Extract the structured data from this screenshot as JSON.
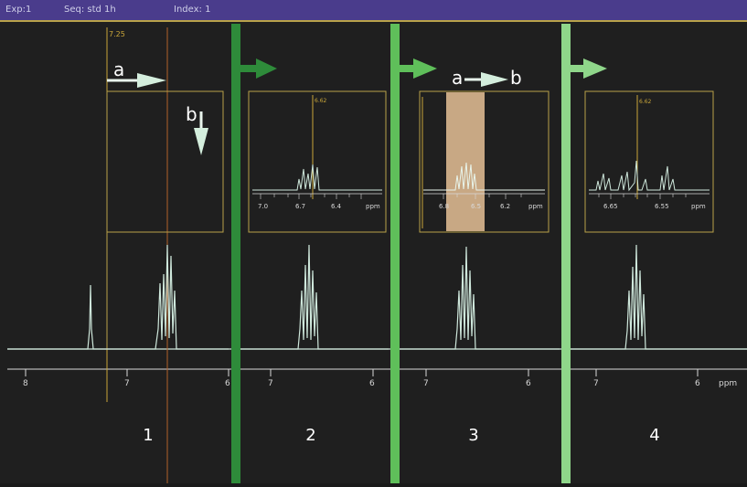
{
  "titlebar": {
    "exp": "Exp:1",
    "seq": "Seq: std 1h",
    "index": "Index: 1"
  },
  "cursor": {
    "main_ppm": "7.25"
  },
  "annotations": {
    "a": "a",
    "b": "b",
    "a_to_b_a": "a",
    "a_to_b_b": "b"
  },
  "panels": [
    {
      "number": "1",
      "axis_ticks": [
        "8",
        "7",
        "6"
      ]
    },
    {
      "number": "2",
      "axis_ticks": [
        "7",
        "6"
      ],
      "inset_cursor": "6.62",
      "inset_ticks": [
        "7.0",
        "6.7",
        "6.4"
      ],
      "inset_unit": "ppm"
    },
    {
      "number": "3",
      "axis_ticks": [
        "7",
        "6"
      ],
      "inset_ticks": [
        "6.8",
        "6.5",
        "6.2"
      ],
      "inset_unit": "ppm"
    },
    {
      "number": "4",
      "axis_ticks": [
        "7",
        "6"
      ],
      "inset_cursor": "6.62",
      "inset_ticks": [
        "6.65",
        "6.55"
      ],
      "inset_unit": "ppm",
      "axis_unit": "ppm"
    }
  ],
  "colors": {
    "divider_dark": "#2e8b3a",
    "divider_light": "#8fd68a",
    "spectrum": "#cfe8dc",
    "cursor_yellow": "#c9a63a",
    "cursor_orange": "#b0602a",
    "selection": "#c8a884"
  }
}
